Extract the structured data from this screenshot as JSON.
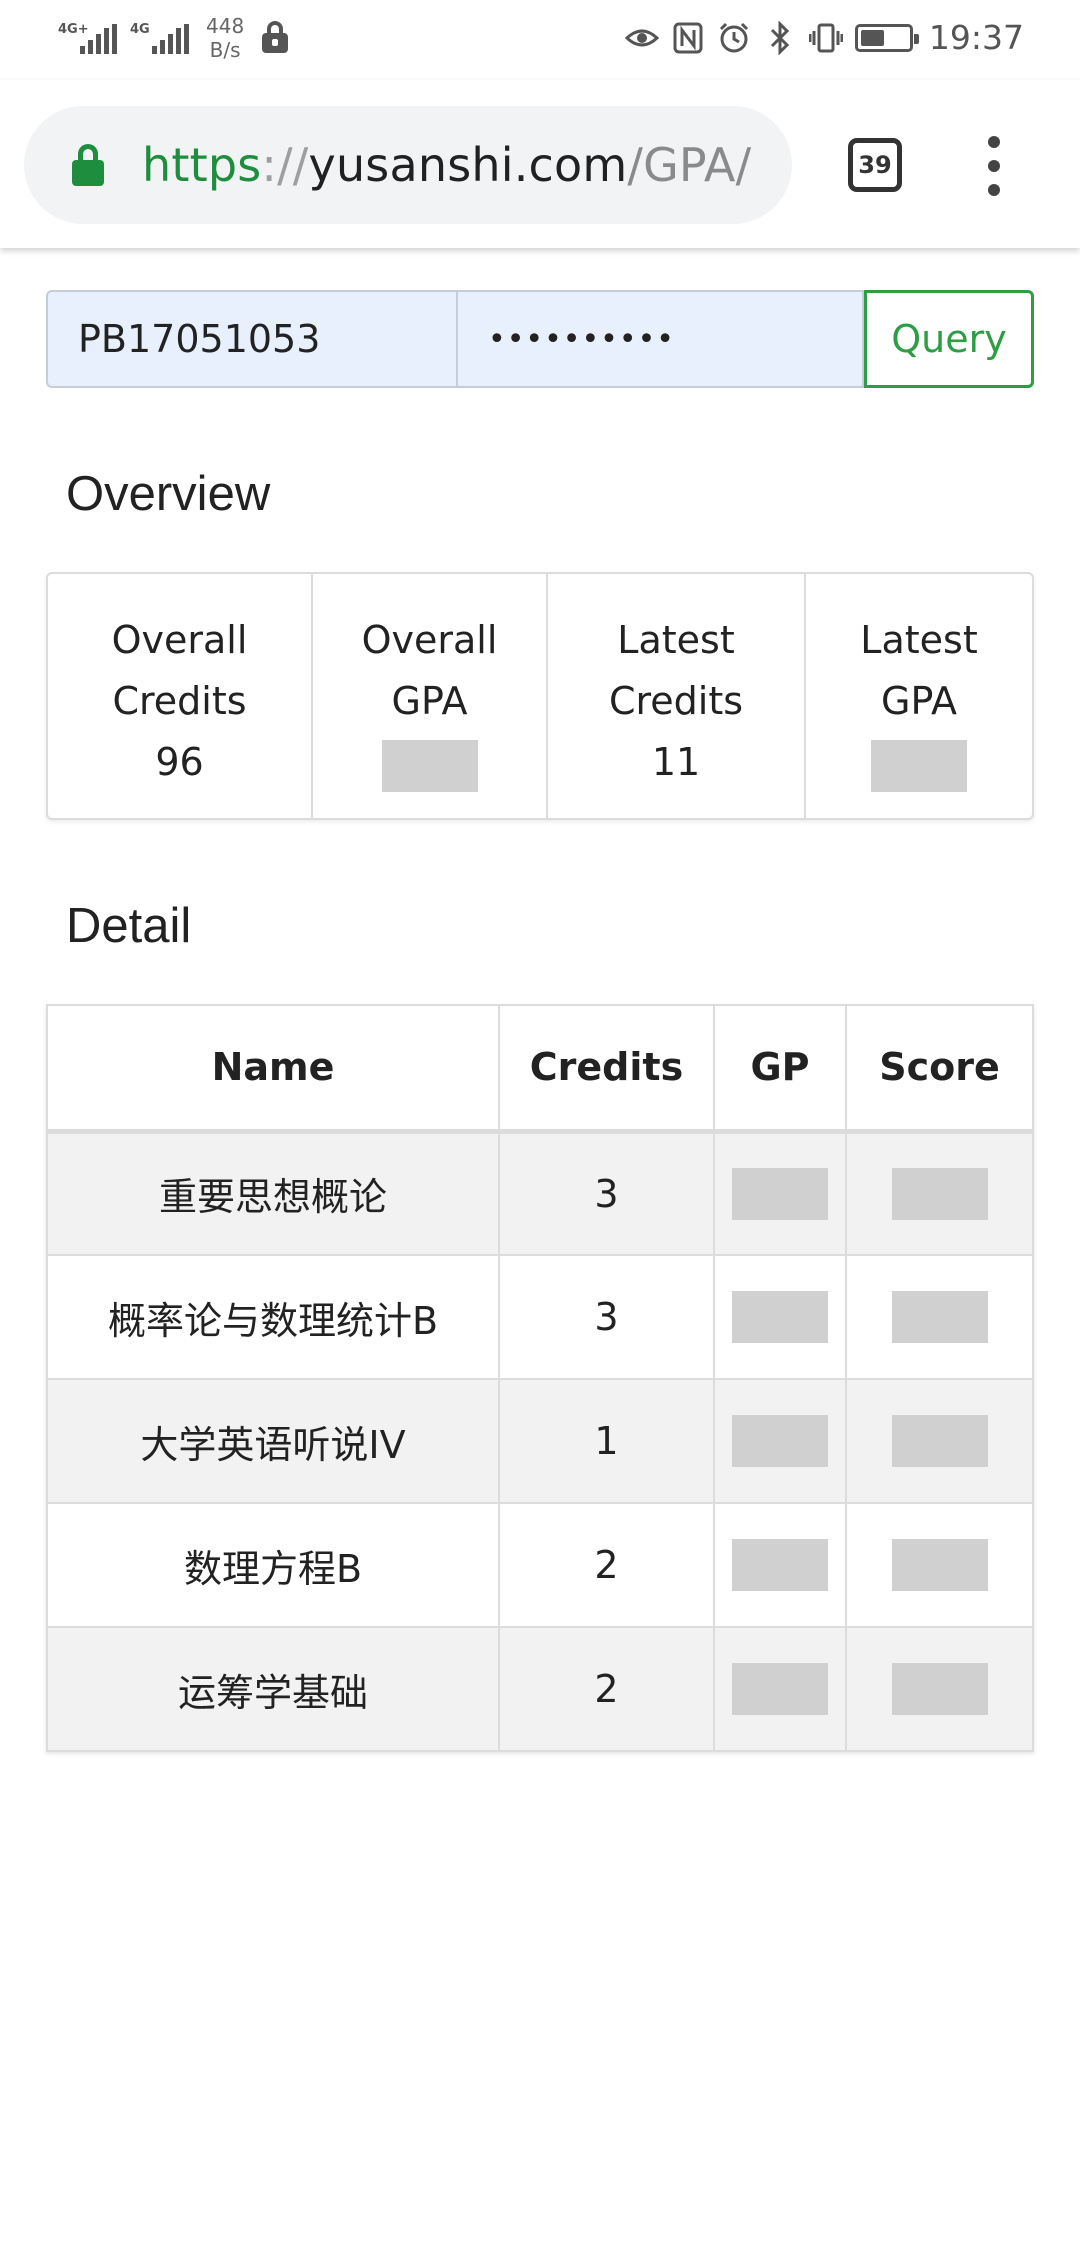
{
  "status_bar": {
    "network_1": "4G+",
    "network_2": "4G",
    "speed_value": "448",
    "speed_unit": "B/s",
    "time": "19:37",
    "battery_level": 0.45
  },
  "browser": {
    "url_scheme": "https",
    "url_sep": "://",
    "url_host": "yusanshi.com",
    "url_path": "/GPA/",
    "tab_count": "39"
  },
  "query": {
    "username": "PB17051053",
    "password": "••••••••••",
    "button_label": "Query"
  },
  "overview": {
    "title": "Overview",
    "overall_credits_label_1": "Overall",
    "overall_credits_label_2": "Credits",
    "overall_credits_value": "96",
    "overall_gpa_label_1": "Overall",
    "overall_gpa_label_2": "GPA",
    "latest_credits_label_1": "Latest",
    "latest_credits_label_2": "Credits",
    "latest_credits_value": "11",
    "latest_gpa_label_1": "Latest",
    "latest_gpa_label_2": "GPA"
  },
  "detail": {
    "title": "Detail",
    "headers": [
      "Name",
      "Credits",
      "GP",
      "Score"
    ],
    "rows": [
      {
        "name": "重要思想概论",
        "credits": "3"
      },
      {
        "name": "概率论与数理统计B",
        "credits": "3"
      },
      {
        "name": "大学英语听说IV",
        "credits": "1"
      },
      {
        "name": "数理方程B",
        "credits": "2"
      },
      {
        "name": "运筹学基础",
        "credits": "2"
      }
    ]
  }
}
